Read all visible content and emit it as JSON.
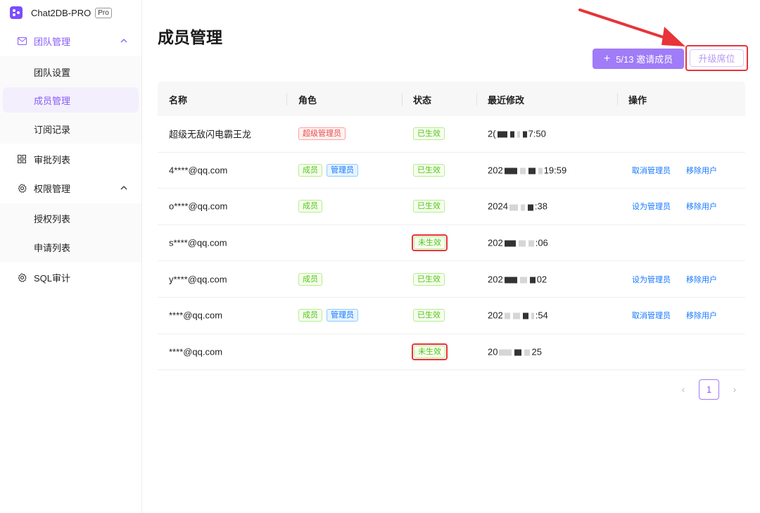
{
  "brand": {
    "name": "Chat2DB-PRO",
    "badge": "Pro"
  },
  "sidebar": {
    "team": {
      "label": "团队管理",
      "children": [
        {
          "label": "团队设置"
        },
        {
          "label": "成员管理"
        },
        {
          "label": "订阅记录"
        }
      ]
    },
    "approval": {
      "label": "审批列表"
    },
    "permission": {
      "label": "权限管理",
      "children": [
        {
          "label": "授权列表"
        },
        {
          "label": "申请列表"
        }
      ]
    },
    "sql_audit": {
      "label": "SQL审计"
    }
  },
  "page": {
    "title": "成员管理",
    "invite_label": "5/13 邀请成员",
    "upgrade_label": "升级席位"
  },
  "table": {
    "headers": {
      "name": "名称",
      "role": "角色",
      "status": "状态",
      "modified": "最近修改",
      "actions": "操作"
    },
    "rows": [
      {
        "name": "超级无敌闪电霸王龙",
        "roles": [
          "超级管理员"
        ],
        "status": "已生效",
        "time_start": "2(",
        "time_end": "7:50",
        "actions": []
      },
      {
        "name": "4****@qq.com",
        "roles": [
          "成员",
          "管理员"
        ],
        "status": "已生效",
        "time_start": "202",
        "time_end": "19:59",
        "actions": [
          "取消管理员",
          "移除用户"
        ]
      },
      {
        "name": "o****@qq.com",
        "roles": [
          "成员"
        ],
        "status": "已生效",
        "time_start": "2024",
        "time_end": ":38",
        "actions": [
          "设为管理员",
          "移除用户"
        ]
      },
      {
        "name": "s****@qq.com",
        "roles": [],
        "status": "未生效",
        "time_start": "202",
        "time_end": ":06",
        "actions": []
      },
      {
        "name": "y****@qq.com",
        "roles": [
          "成员"
        ],
        "status": "已生效",
        "time_start": "202",
        "time_end": "02",
        "actions": [
          "设为管理员",
          "移除用户"
        ]
      },
      {
        "name": "****@qq.com",
        "roles": [
          "成员",
          "管理员"
        ],
        "status": "已生效",
        "time_start": "202",
        "time_end": ":54",
        "actions": [
          "取消管理员",
          "移除用户"
        ]
      },
      {
        "name": "****@qq.com",
        "roles": [],
        "status": "未生效",
        "time_start": "20",
        "time_end": "25",
        "actions": []
      }
    ]
  },
  "pagination": {
    "current": "1",
    "prev": "‹",
    "next": "›"
  },
  "colors": {
    "accent": "#8a5cf6",
    "highlight": "#e8333a"
  }
}
